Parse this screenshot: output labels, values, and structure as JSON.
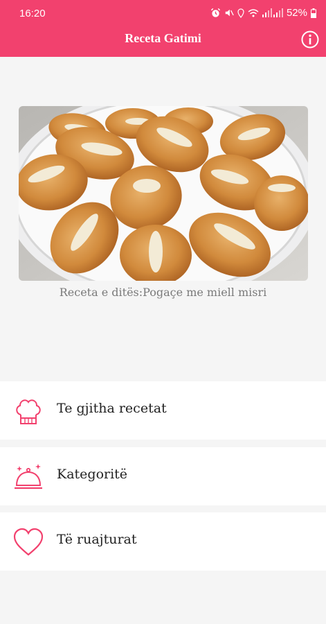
{
  "status_bar": {
    "time": "16:20",
    "battery": "52%"
  },
  "app_bar": {
    "title": "Receta Gatimi",
    "info_icon": "info-icon"
  },
  "recipe_of_day": {
    "caption": "Receta e ditës:Pogaçe me miell misri"
  },
  "menu": {
    "items": [
      {
        "label": "Te gjitha recetat",
        "icon": "chef-hat-icon"
      },
      {
        "label": "Kategoritë",
        "icon": "serving-cloche-icon"
      },
      {
        "label": "Të ruajturat",
        "icon": "heart-icon"
      }
    ]
  },
  "colors": {
    "primary": "#f2416e",
    "background": "#f5f5f5",
    "card": "#ffffff"
  }
}
